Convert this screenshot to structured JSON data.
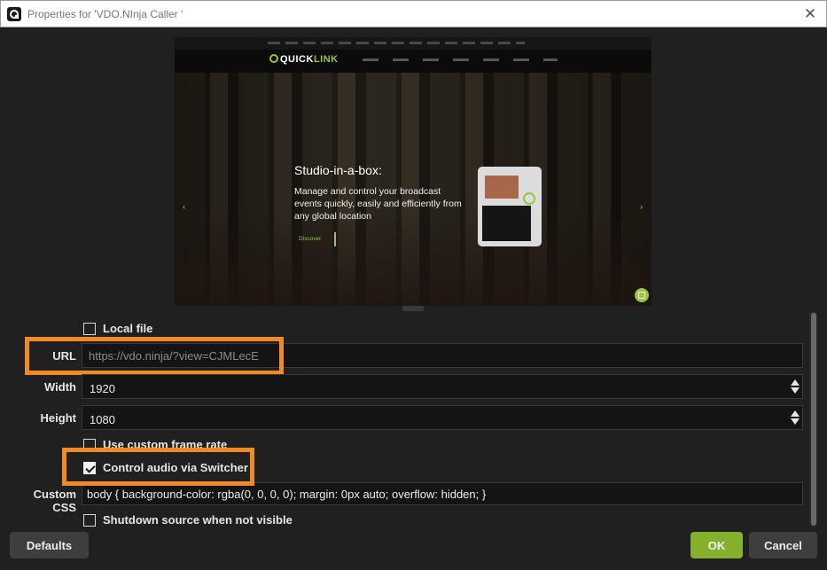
{
  "window": {
    "title": "Properties for 'VDO.NInja Caller '",
    "close_glyph": "✕"
  },
  "preview": {
    "logo_quick": "QUICK",
    "logo_link": "LINK",
    "hero_title": "Studio-in-a-box:",
    "hero_subtitle": "Manage and control your broadcast events quickly, easily and efficiently from any global location",
    "discover_label": "Discover",
    "prev_arrow": "‹",
    "next_arrow": "›",
    "accent_color": "#9bc53d"
  },
  "properties": {
    "local_file": {
      "label": "Local file",
      "checked": false
    },
    "url": {
      "label": "URL",
      "value": "https://vdo.ninja/?view=CJMLecE"
    },
    "width": {
      "label": "Width",
      "value": "1920"
    },
    "height": {
      "label": "Height",
      "value": "1080"
    },
    "custom_frame_rate": {
      "label": "Use custom frame rate",
      "checked": false
    },
    "control_audio": {
      "label": "Control audio via Switcher",
      "checked": true
    },
    "custom_css": {
      "label": "Custom CSS",
      "value": "body { background-color: rgba(0, 0, 0, 0); margin: 0px auto; overflow: hidden; }"
    },
    "shutdown_source": {
      "label": "Shutdown source when not visible",
      "checked": false
    }
  },
  "buttons": {
    "defaults": "Defaults",
    "ok": "OK",
    "cancel": "Cancel"
  },
  "colors": {
    "highlight": "#f08a24",
    "ok_button": "#85b02c",
    "background": "#202020"
  }
}
